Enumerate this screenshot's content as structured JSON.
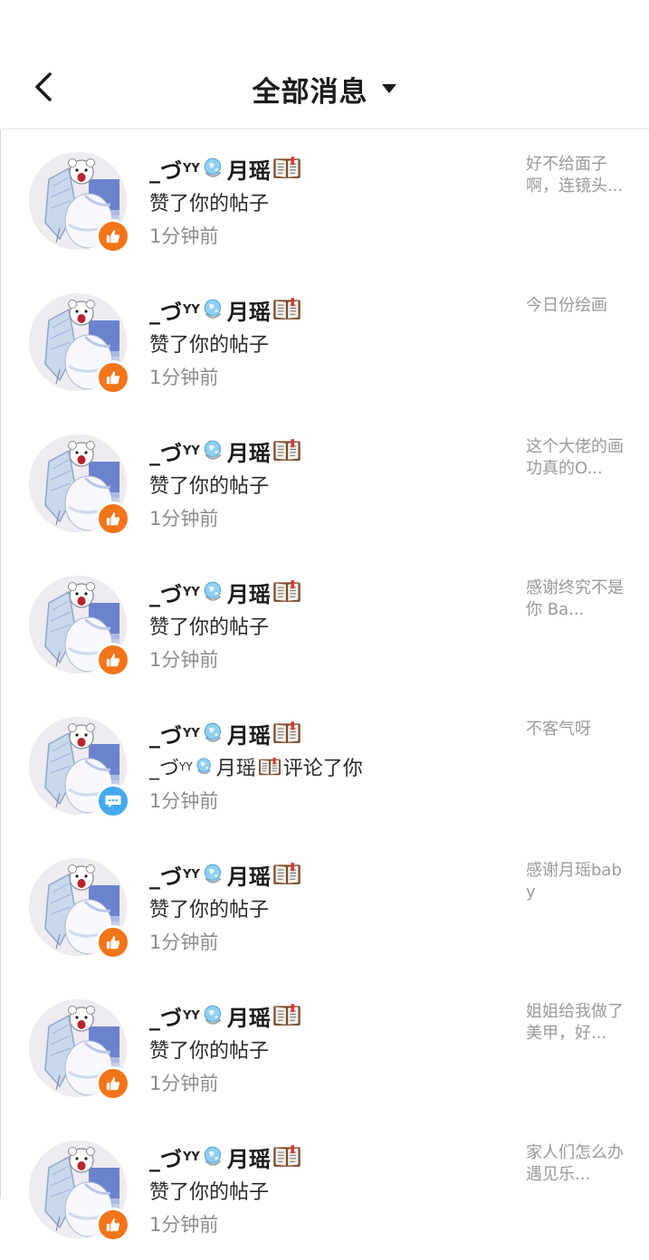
{
  "header": {
    "back_icon": "chevron-left-icon",
    "title": "全部消息",
    "dropdown_icon": "caret-down-icon"
  },
  "messages": [
    {
      "name_prefix": "_づ",
      "name_yy": "YY",
      "name_main": "月瑶",
      "action": "赞了你的帖子",
      "action_type": "like",
      "time": "1分钟前",
      "preview": "好不给面子啊，连镜头..."
    },
    {
      "name_prefix": "_づ",
      "name_yy": "YY",
      "name_main": "月瑶",
      "action": "赞了你的帖子",
      "action_type": "like",
      "time": "1分钟前",
      "preview": "今日份绘画"
    },
    {
      "name_prefix": "_づ",
      "name_yy": "YY",
      "name_main": "月瑶",
      "action": "赞了你的帖子",
      "action_type": "like",
      "time": "1分钟前",
      "preview": "这个大佬的画功真的O..."
    },
    {
      "name_prefix": "_づ",
      "name_yy": "YY",
      "name_main": "月瑶",
      "action": "赞了你的帖子",
      "action_type": "like",
      "time": "1分钟前",
      "preview": "感谢终究不是你 Ba..."
    },
    {
      "name_prefix": "_づ",
      "name_yy": "YY",
      "name_main": "月瑶",
      "action_prefix": "_づ",
      "action_yy": "YY",
      "action_name": "月瑶",
      "action": "评论了你",
      "action_type": "comment",
      "time": "1分钟前",
      "preview": "不客气呀"
    },
    {
      "name_prefix": "_づ",
      "name_yy": "YY",
      "name_main": "月瑶",
      "action": "赞了你的帖子",
      "action_type": "like",
      "time": "1分钟前",
      "preview": "感谢月瑶baby"
    },
    {
      "name_prefix": "_づ",
      "name_yy": "YY",
      "name_main": "月瑶",
      "action": "赞了你的帖子",
      "action_type": "like",
      "time": "1分钟前",
      "preview": "姐姐给我做了美甲，好..."
    },
    {
      "name_prefix": "_づ",
      "name_yy": "YY",
      "name_main": "月瑶",
      "action": "赞了你的帖子",
      "action_type": "like",
      "time": "1分钟前",
      "preview": "家人们怎么办 遇见乐..."
    }
  ],
  "colors": {
    "like_badge": "#f2751a",
    "comment_badge": "#45a9f0",
    "time_text": "#8d8d8d",
    "preview_text": "#9a9a9a"
  },
  "icons": {
    "like_badge": "thumbs-up-icon",
    "comment_badge": "chat-bubble-icon",
    "name_emoji_1": "globe-icon",
    "name_emoji_2": "open-book-icon",
    "avatar": "polar-bear-avatar"
  }
}
